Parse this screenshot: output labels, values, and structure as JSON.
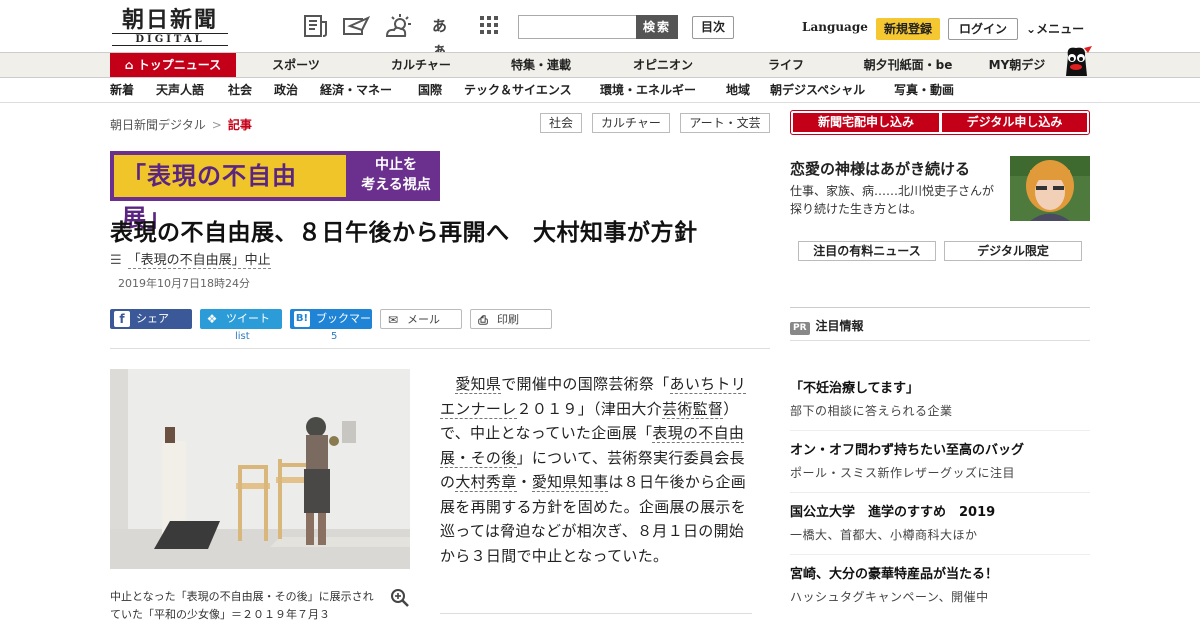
{
  "header": {
    "logo_jp": "朝日新聞",
    "logo_en": "DIGITAL",
    "icons": [
      "newspaper-icon",
      "paper-plane-icon",
      "weather-icon",
      "font-size-icon",
      "grid-menu-icon"
    ],
    "font_size_label": "あぁ",
    "search_placeholder": "",
    "search_label": "検索",
    "toc_label": "目次",
    "language_label": "Language",
    "register_label": "新規登録",
    "login_label": "ログイン",
    "menu_label": "メニュー"
  },
  "nav_main": [
    "トップニュース",
    "スポーツ",
    "カルチャー",
    "特集・連載",
    "オピニオン",
    "ライフ",
    "朝夕刊紙面・be",
    "MY朝デジ"
  ],
  "nav_sub": [
    "新着",
    "天声人語",
    "社会",
    "政治",
    "経済・マネー",
    "国際",
    "テック＆サイエンス",
    "環境・エネルギー",
    "地域",
    "朝デジスペシャル",
    "写真・動画"
  ],
  "breadcrumb": {
    "home": "朝日新聞デジタル",
    "current": "記事"
  },
  "tags": [
    "社会",
    "カルチャー",
    "アート・文芸"
  ],
  "banner": {
    "title": "表現の不自由展",
    "sub_line1": "中止を",
    "sub_line2": "考える視点"
  },
  "article": {
    "headline": "表現の不自由展、８日午後から再開へ　大村知事が方針",
    "series_link": "「表現の不自由展」中止",
    "date": "2019年10月7日18時24分",
    "share": {
      "facebook": "シェア",
      "twitter": "ツイート",
      "twitter_count": "list",
      "hatena": "ブックマーク",
      "hatena_count": "5",
      "mail": "メール",
      "print": "印刷"
    },
    "caption": "中止となった「表現の不自由展・その後」に展示されていた「平和の少女像」＝２０１９年７月３",
    "body": {
      "p1": "愛知県",
      "p2": "で開催中の国際芸術祭「",
      "p3": "あいちトリエンナーレ",
      "p4": "２０１９」（津田大介",
      "p5": "芸術監督",
      "p6": "）で、中止となっていた企画展「",
      "p7": "表現の不自由展・その後",
      "p8": "」について、芸術祭実行委員会長の",
      "p9": "大村秀章",
      "p10": "・",
      "p11": "愛知県知事",
      "p12": "は８日午後から企画展を再開する方針を固めた。企画展の展示を巡っては脅迫などが相次ぎ、８月１日の開始から３日間で中止となっていた。"
    }
  },
  "sidebar": {
    "cta_newspaper": "新聞宅配申し込み",
    "cta_digital": "デジタル申し込み",
    "promo_title": "恋愛の神様はあがき続ける",
    "promo_desc": "仕事、家族、病……北川悦吏子さんが探り続けた生き方とは。",
    "tab_news": "注目の有料ニュース",
    "tab_digital": "デジタル限定",
    "pr_badge": "PR",
    "pr_heading": "注目情報",
    "pr_items": [
      {
        "title": "「不妊治療してます」",
        "desc": "部下の相談に答えられる企業"
      },
      {
        "title": "オン・オフ問わず持ちたい至高のバッグ",
        "desc": "ポール・スミス新作レザーグッズに注目"
      },
      {
        "title": "国公立大学　進学のすすめ　2019",
        "desc": "一橋大、首都大、小樽商科大ほか"
      },
      {
        "title": "宮崎、大分の豪華特産品が当たる！",
        "desc": "ハッシュタグキャンペーン、開催中"
      }
    ]
  },
  "colors": {
    "accent_red": "#c40018",
    "register_yellow": "#f5c832",
    "banner_purple": "#6b2f8e",
    "banner_yellow": "#f0c52a",
    "facebook": "#3b5998",
    "twitter": "#2c9cd8",
    "hatena": "#1f83d6"
  }
}
